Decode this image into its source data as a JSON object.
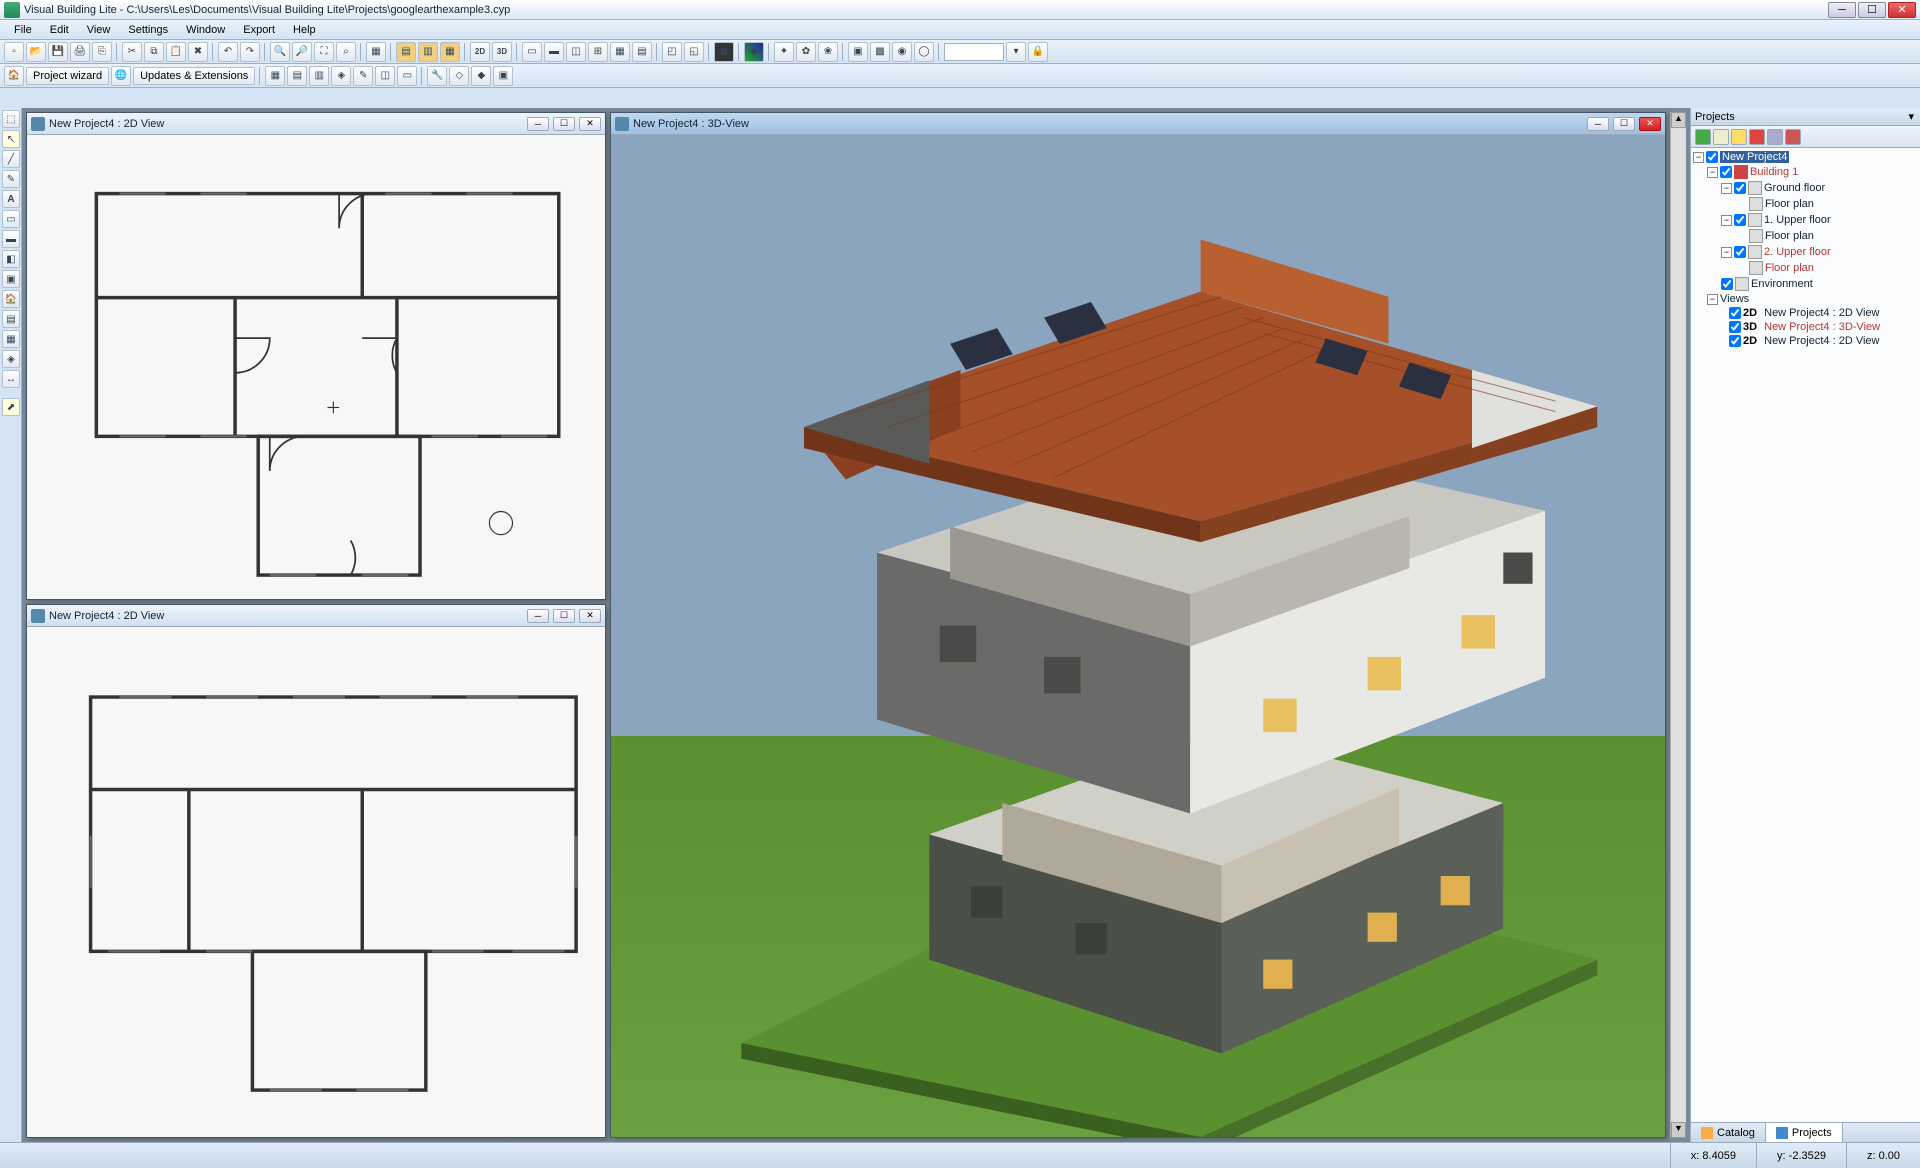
{
  "app": {
    "title": "Visual Building Lite - C:\\Users\\Les\\Documents\\Visual Building Lite\\Projects\\googlearthexample3.cyp"
  },
  "menu": [
    "File",
    "Edit",
    "View",
    "Settings",
    "Window",
    "Export",
    "Help"
  ],
  "toolbar2": {
    "project_wizard": "Project wizard",
    "updates": "Updates & Extensions"
  },
  "windows": {
    "plan1": "New Project4 : 2D View",
    "plan2": "New Project4 : 2D View",
    "view3d": "New Project4 : 3D-View"
  },
  "projects": {
    "panel_title": "Projects",
    "root": "New Project4",
    "building": "Building 1",
    "ground": "Ground floor",
    "floorplan": "Floor plan",
    "upper1": "1. Upper floor",
    "upper2": "2. Upper floor",
    "env": "Environment",
    "views": "Views",
    "v1_prefix": "2D",
    "v1": "New Project4 : 2D View",
    "v2_prefix": "3D",
    "v2": "New Project4 : 3D-View",
    "v3_prefix": "2D",
    "v3": "New Project4 : 2D View"
  },
  "bottom_tabs": {
    "catalog": "Catalog",
    "projects": "Projects"
  },
  "status": {
    "x": "x: 8.4059",
    "y": "y: -2.3529",
    "z": "z: 0.00"
  }
}
